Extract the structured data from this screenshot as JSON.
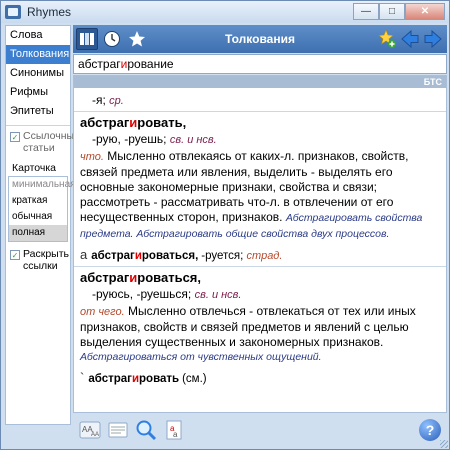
{
  "window": {
    "title": "Rhymes"
  },
  "sidebar": {
    "items": [
      {
        "label": "Слова",
        "active": false
      },
      {
        "label": "Толкования",
        "active": true
      },
      {
        "label": "Синонимы",
        "active": false
      },
      {
        "label": "Рифмы",
        "active": false
      },
      {
        "label": "Эпитеты",
        "active": false
      }
    ],
    "ref_articles_label": "Ссылочные статьи",
    "card_label": "Карточка",
    "card_options": [
      {
        "label": "минимальная",
        "state": "dim"
      },
      {
        "label": "краткая",
        "state": "normal"
      },
      {
        "label": "обычная",
        "state": "normal"
      },
      {
        "label": "полная",
        "state": "selected"
      }
    ],
    "expand_links_label": "Раскрыть ссылки"
  },
  "toolbar": {
    "title": "Толкования"
  },
  "search": {
    "value_pre": "абстраг",
    "value_acc": "и",
    "value_post": "рование"
  },
  "source": "БТС",
  "entries": {
    "top_forms": "-я;",
    "top_gram": "ср.",
    "e1": {
      "hw_pre": "абстраг",
      "hw_acc": "и",
      "hw_post": "ровать,",
      "forms": "-рую, -руешь;",
      "gram": "св. и нсв.",
      "label": "что.",
      "definition": "Мысленно отвлекаясь от каких-л. признаков, свойств, связей предмета или явления, выделить - выделять его основные закономерные признаки, свойства и связи; рассмотреть - рассматривать что-л. в отвлечении от его несущественных сторон, признаков.",
      "examples": "Абстрагировать свойства предмета. Абстрагировать общие свойства двух процессов.",
      "deriv_mark": "a",
      "deriv_hw_pre": "абстраг",
      "deriv_hw_acc": "и",
      "deriv_hw_post": "роваться,",
      "deriv_forms": "-руется;",
      "deriv_gram": "страд."
    },
    "e2": {
      "hw_pre": "абстраг",
      "hw_acc": "и",
      "hw_post": "роваться,",
      "forms": "-руюсь, -руешься;",
      "gram": "св. и нсв.",
      "label": "от чего.",
      "definition": "Мысленно отвлечься - отвлекаться от тех или иных признаков, свойств и связей предметов и явлений с целью выделения существенных и закономерных признаков.",
      "examples": "Абстрагироваться от чувственных ощущений.",
      "ref_mark": "`",
      "ref_hw_pre": "абстраг",
      "ref_hw_acc": "и",
      "ref_hw_post": "ровать",
      "ref_note": "(см.)"
    }
  },
  "colors": {
    "accent": "#3c7fd0",
    "toolbar": "#4f80be",
    "stress": "#dd0000"
  }
}
